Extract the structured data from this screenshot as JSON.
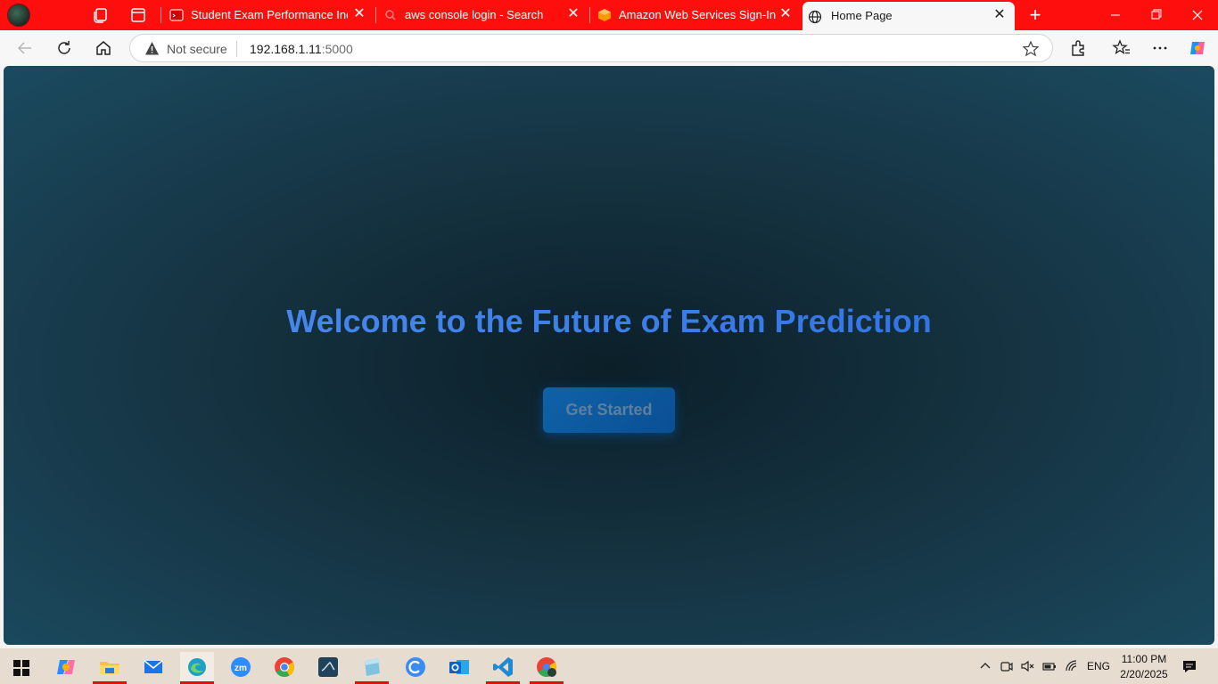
{
  "browser": {
    "tabs": [
      {
        "label": "Student Exam Performance Indica",
        "favicon": "red-app-icon",
        "active": false
      },
      {
        "label": "aws console login - Search",
        "favicon": "search-icon",
        "active": false
      },
      {
        "label": "Amazon Web Services Sign-In",
        "favicon": "aws-cube-icon",
        "active": false
      },
      {
        "label": "Home Page",
        "favicon": "globe-icon",
        "active": true
      }
    ],
    "tab_strip_color": "#ff0e0e",
    "security_label": "Not secure",
    "url_host": "192.168.1.11",
    "url_port": ":5000"
  },
  "page": {
    "heading": "Welcome to the Future of Exam Prediction",
    "cta_label": "Get Started",
    "heading_color": "#3a7fea",
    "button_color": "#0f62a8"
  },
  "taskbar": {
    "apps": [
      "copilot",
      "file-explorer",
      "mail",
      "edge",
      "zoom",
      "chrome",
      "mysql-workbench",
      "notepad",
      "canva",
      "outlook",
      "vscode",
      "chrome-profile"
    ],
    "language": "ENG",
    "time": "11:00 PM",
    "date": "2/20/2025"
  }
}
